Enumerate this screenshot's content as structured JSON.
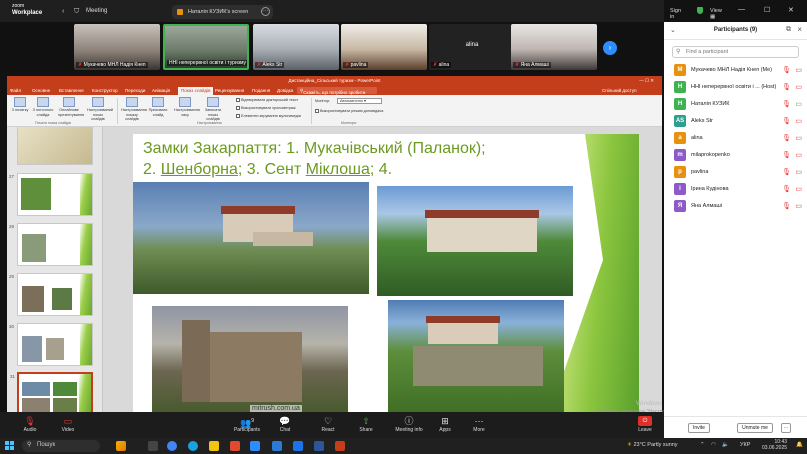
{
  "zoom": {
    "logo_line1": "zoom",
    "logo_line2": "Workplace",
    "meeting_label": "Meeting",
    "share_banner": "Наталія КУЗИК's screen",
    "sign_in": "Sign in",
    "view": "View",
    "tiles": [
      {
        "name": "Мукачево МНЛ Надія Кнеп",
        "muted": true
      },
      {
        "name": "ННІ неперервної освіти і туризму",
        "muted": true,
        "active": true
      },
      {
        "name": "Aleks Str",
        "muted": true
      },
      {
        "name": "pavlina",
        "muted": true
      },
      {
        "name": "alina",
        "muted": true,
        "name_only": true
      },
      {
        "name": "Яна Алмаші",
        "muted": true
      }
    ],
    "toolbar": {
      "audio": "Audio",
      "video": "Video",
      "participants": "Participants",
      "participants_count": "9",
      "chat": "Chat",
      "react": "React",
      "share": "Share",
      "meeting_info": "Meeting info",
      "apps": "Apps",
      "more": "More",
      "leave": "Leave"
    }
  },
  "ppt": {
    "window_title": "Дистанційна_Сільський туризм - PowerPoint",
    "account": "Спільний доступ",
    "tabs": [
      "Файл",
      "Основне",
      "Вставлення",
      "Конструктор",
      "Переходи",
      "Анімація",
      "Показ слайдів",
      "Рецензування",
      "Подання",
      "Довідка",
      "Acrobat"
    ],
    "selected_tab": "Показ слайдів",
    "search_placeholder": "Скажіть, що потрібно зробити",
    "ribbon": {
      "buttons": [
        "З початку",
        "З поточного слайда",
        "Онлайнове презентування",
        "Настроюваний показ слайдів",
        "Настроювання показу слайдів",
        "Приховати слайд",
        "Настроювання часу",
        "Записати показ слайдів"
      ],
      "group1": "Почати показ слайдів",
      "group2": "Настроювання",
      "group3": "Монітори",
      "checks": [
        "Відтворювати дикторський текст",
        "Використовувати хронометраж",
        "Елементи керування мультимедіа"
      ],
      "monitor_label": "Монітор:",
      "monitor_value": "Автоматично",
      "presenter_check": "Використовувати режим доповідача"
    },
    "thumbs": [
      {
        "num": "26"
      },
      {
        "num": "27"
      },
      {
        "num": "28"
      },
      {
        "num": "29"
      },
      {
        "num": "30"
      },
      {
        "num": "31",
        "selected": true
      }
    ],
    "slide": {
      "title_line1": "Замки Закарпаття: 1. Мукачівський (Паланок);",
      "title_l2_prefix": "2. ",
      "title_l2_a": "Шенборна",
      "title_l2_mid": "; 3. Сент ",
      "title_l2_b": "Міклоша",
      "title_l2_end": "; 4.",
      "watermark": "mitrush.com.ua"
    }
  },
  "windows_activation": {
    "line1": "Windows",
    "line2": "Перейдіть до розділу \"Настройки\", щоб активувати Windows."
  },
  "participants_panel": {
    "title": "Participants (9)",
    "search_placeholder": "Find a participant",
    "people": [
      {
        "initial": "M",
        "color": "#e8910f",
        "name": "Мукачево МНЛ Надія Кнеп (Me)",
        "cam_on": false
      },
      {
        "initial": "H",
        "color": "#3fb34f",
        "name": "ННІ неперервної освіти і ... (Host)",
        "cam_on": false
      },
      {
        "initial": "H",
        "color": "#3fb34f",
        "name": "Наталія КУЗИК",
        "cam_on": true
      },
      {
        "initial": "AS",
        "color": "#2e9e8f",
        "name": "Aleks Str",
        "cam_on": false
      },
      {
        "initial": "a",
        "color": "#e8910f",
        "name": "alina",
        "cam_on": false
      },
      {
        "initial": "m",
        "color": "#8e5ac8",
        "name": "milaprokopenko",
        "cam_on": false
      },
      {
        "initial": "p",
        "color": "#e8910f",
        "name": "pavlina",
        "cam_on": false
      },
      {
        "initial": "I",
        "color": "#8e5ac8",
        "name": "Ірина Кудінова",
        "cam_on": false
      },
      {
        "initial": "Я",
        "color": "#8e5ac8",
        "name": "Яна Алмаші",
        "cam_on": false
      }
    ],
    "invite": "Invite",
    "unmute_me": "Unmute me"
  },
  "taskbar": {
    "search": "Пошук",
    "temperature": "23°C",
    "weather": "Partly sunny",
    "lang": "УКР",
    "time": "10:43",
    "date": "03.06.2025"
  }
}
